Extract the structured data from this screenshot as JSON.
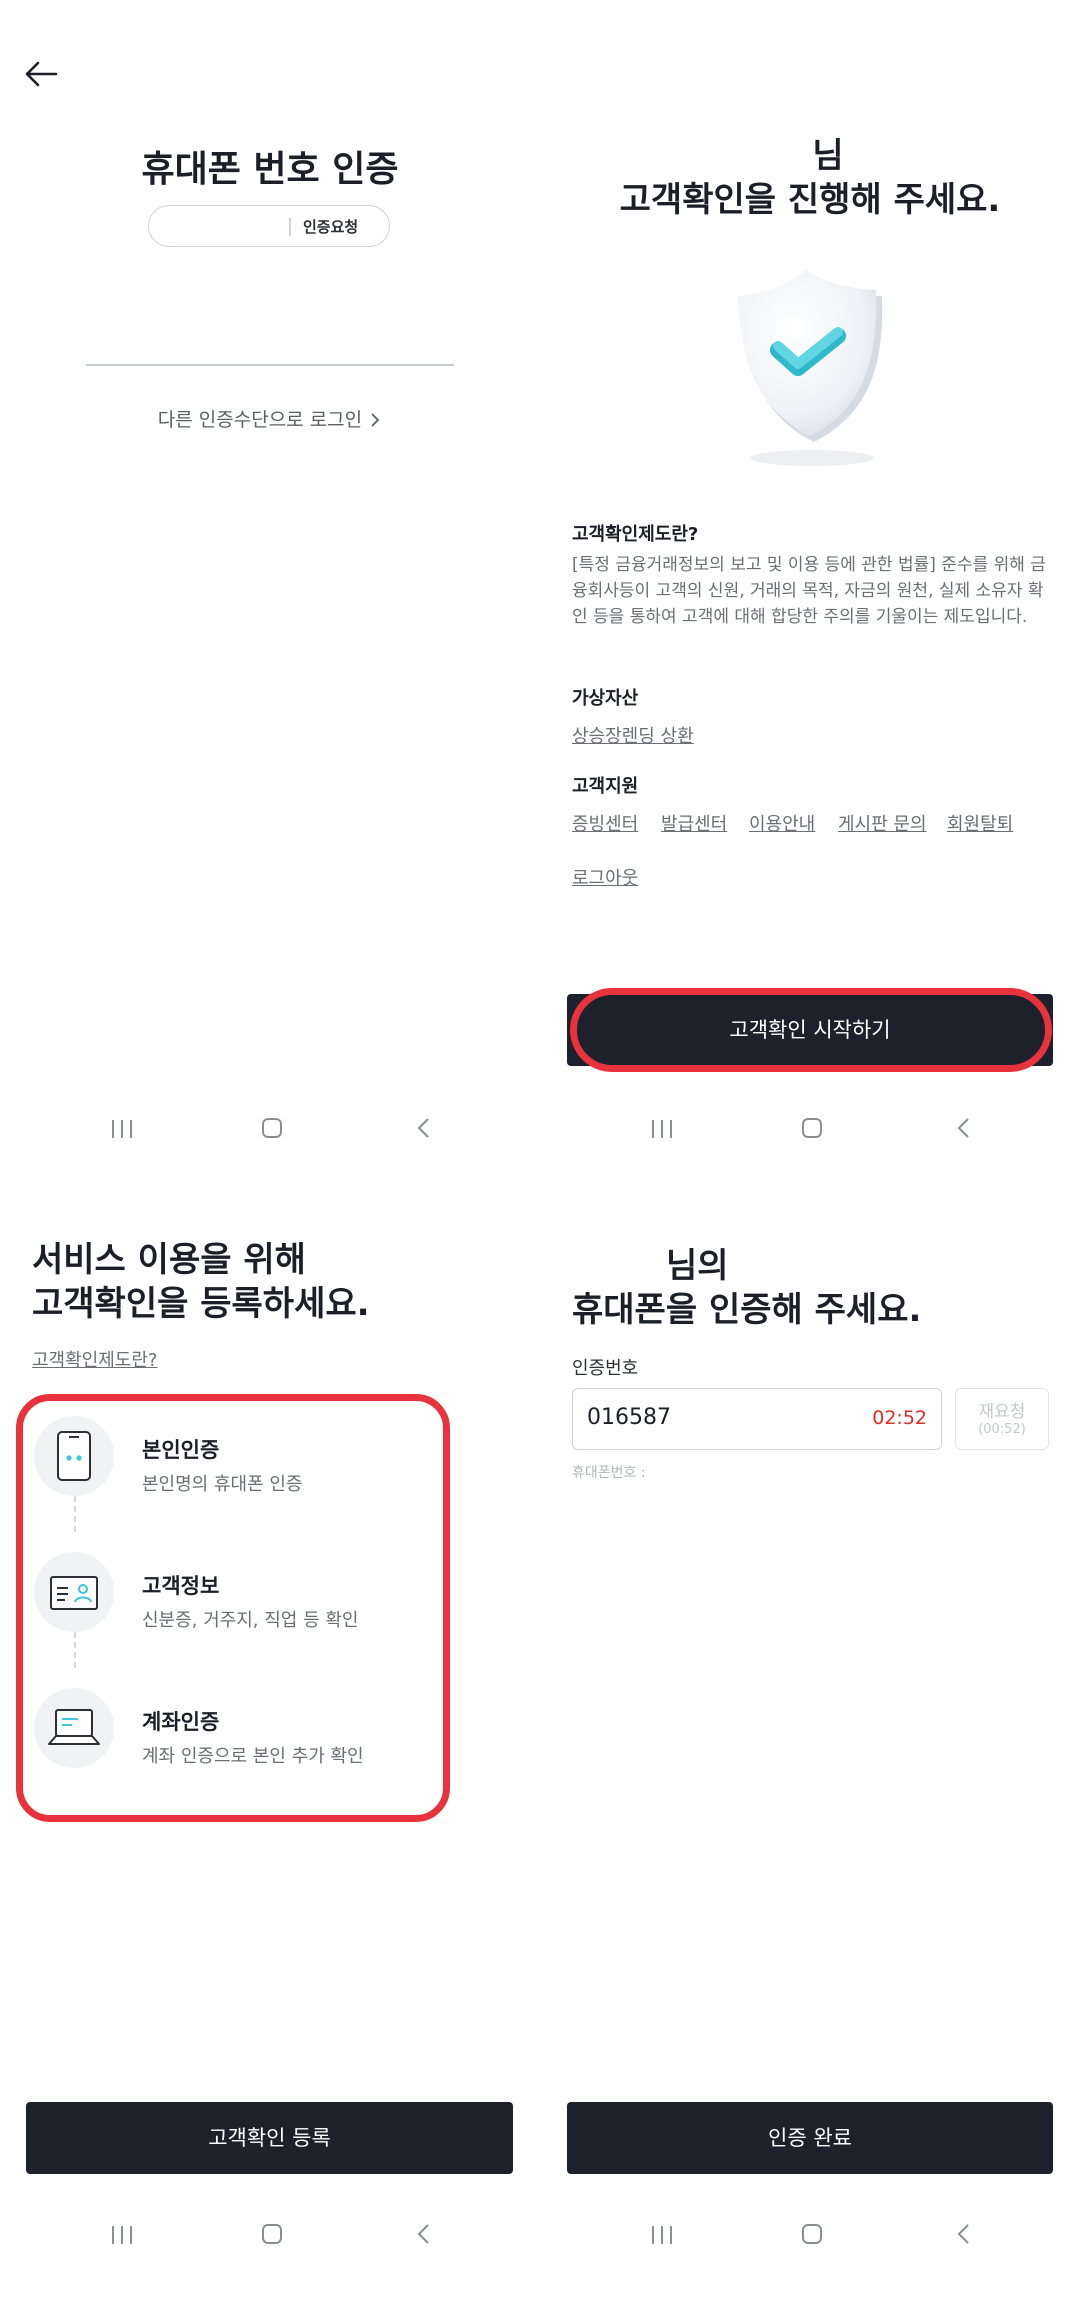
{
  "panel1": {
    "title": "휴대폰 번호 인증",
    "request_label": "인증요청",
    "other_login": "다른 인증수단으로 로그인"
  },
  "panel2": {
    "name_suffix": "님",
    "title": "고객확인을 진행해 주세요.",
    "info_title": "고객확인제도란?",
    "info_text": "[특정 금융거래정보의 보고 및 이용 등에 관한 법률] 준수를 위해 금융회사등이 고객의 신원, 거래의 목적, 자금의 원천, 실제 소유자 확인 등을 통하여 고객에 대해 합당한 주의를 기울이는 제도입니다.",
    "section_asset": "가상자산",
    "asset_link": "상승장렌딩 상환",
    "section_support": "고객지원",
    "support_links": [
      "증빙센터",
      "발급센터",
      "이용안내",
      "게시판 문의",
      "회원탈퇴"
    ],
    "logout": "로그아웃",
    "start_button": "고객확인 시작하기"
  },
  "panel3": {
    "title_line1": "서비스 이용을 위해",
    "title_line2": "고객확인을 등록하세요.",
    "link": "고객확인제도란?",
    "steps": [
      {
        "title": "본인인증",
        "sub": "본인명의 휴대폰 인증"
      },
      {
        "title": "고객정보",
        "sub": "신분증, 거주지, 직업 등 확인"
      },
      {
        "title": "계좌인증",
        "sub": "계좌 인증으로 본인 추가 확인"
      }
    ],
    "register_button": "고객확인 등록"
  },
  "panel4": {
    "name_suffix": "님의",
    "title": "휴대폰을 인증해 주세요.",
    "code_label": "인증번호",
    "code_value": "016587",
    "timer": "02:52",
    "resend_label": "재요청",
    "resend_timer": "(00:52)",
    "phone_label": "휴대폰번호 :",
    "done_button": "인증 완료"
  },
  "colors": {
    "primary_button": "#1c212b",
    "highlight": "#e8323c",
    "timer": "#e02a2a",
    "shield_check": "#3cc6d6"
  },
  "icons": [
    "back-arrow-icon",
    "shield-check-icon",
    "phone-icon",
    "id-card-icon",
    "laptop-icon",
    "recent-apps-icon",
    "home-icon",
    "nav-back-icon"
  ]
}
